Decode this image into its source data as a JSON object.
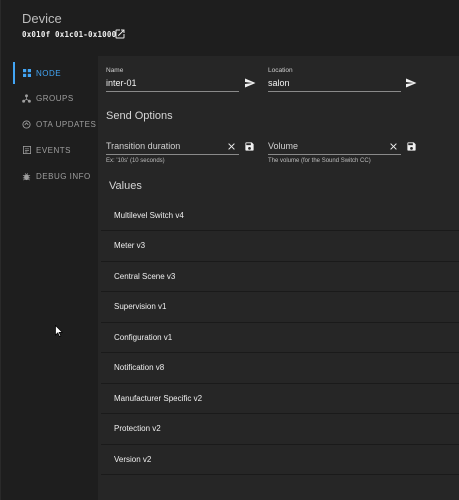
{
  "header": {
    "title": "Device",
    "subtitle": "0x010f 0x1c01-0x1000",
    "open_icon": "open-in-new-icon"
  },
  "sidebar": {
    "items": [
      {
        "label": "NODE",
        "icon": "grid-icon",
        "active": true
      },
      {
        "label": "GROUPS",
        "icon": "group-icon",
        "active": false
      },
      {
        "label": "OTA UPDATES",
        "icon": "ota-icon",
        "active": false
      },
      {
        "label": "EVENTS",
        "icon": "events-icon",
        "active": false
      },
      {
        "label": "DEBUG INFO",
        "icon": "bug-icon",
        "active": false
      }
    ]
  },
  "fields": {
    "name": {
      "label": "Name",
      "value": "inter-01"
    },
    "location": {
      "label": "Location",
      "value": "salon"
    }
  },
  "send_options": {
    "title": "Send Options",
    "transition": {
      "placeholder": "Transition duration",
      "hint": "Ex: '10s' (10 seconds)"
    },
    "volume": {
      "placeholder": "Volume",
      "hint": "The volume (for the Sound Switch CC)"
    }
  },
  "values": {
    "title": "Values",
    "items": [
      "Multilevel Switch v4",
      "Meter v3",
      "Central Scene v3",
      "Supervision v1",
      "Configuration v1",
      "Notification v8",
      "Manufacturer Specific v2",
      "Protection v2",
      "Version v2"
    ]
  },
  "colors": {
    "accent": "#42a5f5",
    "background": "#1e1e1e",
    "panel": "#262626"
  }
}
